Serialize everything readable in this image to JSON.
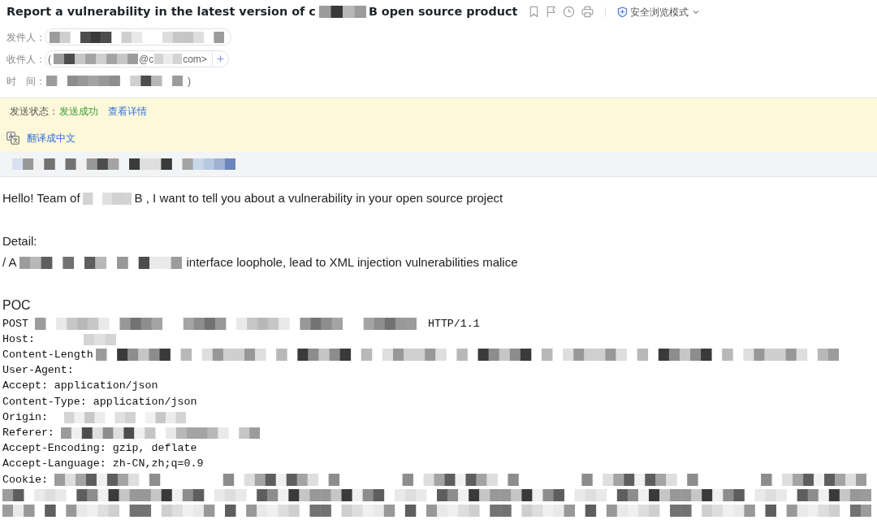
{
  "subject": {
    "parts": [
      {
        "kind": "text",
        "text": "Report a vulnerability in the latest version of c"
      },
      {
        "kind": "redacted"
      },
      {
        "kind": "text",
        "text": "B open source product"
      }
    ]
  },
  "reading_mode": {
    "label": "安全浏览模式"
  },
  "header_fields": [
    {
      "kind": "contact",
      "label": "发件人：",
      "addable": false,
      "parts": [
        {
          "kind": "redacted"
        }
      ]
    },
    {
      "kind": "contact",
      "label": "收件人：",
      "addable": true,
      "parts": [
        {
          "kind": "text",
          "text": "("
        },
        {
          "kind": "redacted"
        },
        {
          "kind": "text",
          "text": "@c"
        },
        {
          "kind": "redacted"
        },
        {
          "kind": "text",
          "text": "com>"
        }
      ]
    },
    {
      "kind": "plain",
      "label": "时　间：",
      "addable": false,
      "parts": [
        {
          "kind": "redacted"
        },
        {
          "kind": "text",
          "text": ")"
        }
      ]
    }
  ],
  "send_status": {
    "label": "发送状态：",
    "status": "发送成功",
    "details_link": "查看详情"
  },
  "translate": {
    "link": "翻译成中文"
  },
  "notice_bar": {
    "parts": [
      {
        "kind": "redacted"
      }
    ]
  },
  "body": {
    "paragraphs": [
      {
        "lines": [
          {
            "kind": "prose",
            "parts": [
              {
                "kind": "text",
                "text": "Hello! Team of"
              },
              {
                "kind": "redacted"
              },
              {
                "kind": "text",
                "text": "B , I want to tell you about a vulnerability in your open source project"
              }
            ]
          }
        ]
      },
      {
        "lines": [
          {
            "kind": "prose",
            "parts": [
              {
                "kind": "text",
                "text": "Detail:"
              }
            ]
          },
          {
            "kind": "prose",
            "parts": [
              {
                "kind": "text",
                "text": "/ A"
              },
              {
                "kind": "redacted"
              },
              {
                "kind": "text",
                "text": "interface loophole, lead to XML injection vulnerabilities malice"
              }
            ]
          }
        ]
      },
      {
        "lines": [
          {
            "kind": "heading",
            "parts": [
              {
                "kind": "text",
                "text": "POC"
              }
            ]
          },
          {
            "kind": "code",
            "parts": [
              {
                "kind": "text",
                "text": "POST"
              },
              {
                "kind": "redacted"
              },
              {
                "kind": "text",
                "text": "HTTP/1.1"
              }
            ]
          },
          {
            "kind": "code",
            "parts": [
              {
                "kind": "text",
                "text": "Host:"
              },
              {
                "kind": "redacted"
              }
            ]
          },
          {
            "kind": "code",
            "parts": [
              {
                "kind": "text",
                "text": "Content-Length"
              },
              {
                "kind": "redacted"
              }
            ]
          },
          {
            "kind": "code",
            "parts": [
              {
                "kind": "text",
                "text": "User-Agent:"
              }
            ]
          },
          {
            "kind": "code",
            "parts": [
              {
                "kind": "text",
                "text": "Accept: application/json"
              }
            ]
          },
          {
            "kind": "code",
            "parts": [
              {
                "kind": "text",
                "text": "Content-Type: application/json"
              }
            ]
          },
          {
            "kind": "code",
            "parts": [
              {
                "kind": "text",
                "text": "Origin:"
              },
              {
                "kind": "redacted"
              }
            ]
          },
          {
            "kind": "code",
            "parts": [
              {
                "kind": "text",
                "text": "Referer:"
              },
              {
                "kind": "redacted"
              }
            ]
          },
          {
            "kind": "code",
            "parts": [
              {
                "kind": "text",
                "text": "Accept-Encoding: gzip, deflate"
              }
            ]
          },
          {
            "kind": "code",
            "parts": [
              {
                "kind": "text",
                "text": "Accept-Language: zh-CN,zh;q=0.9"
              }
            ]
          },
          {
            "kind": "code",
            "parts": [
              {
                "kind": "text",
                "text": "Cookie:"
              },
              {
                "kind": "redacted"
              }
            ]
          },
          {
            "kind": "code",
            "parts": [
              {
                "kind": "redacted"
              }
            ]
          },
          {
            "kind": "code",
            "parts": [
              {
                "kind": "redacted"
              }
            ]
          }
        ]
      }
    ]
  }
}
